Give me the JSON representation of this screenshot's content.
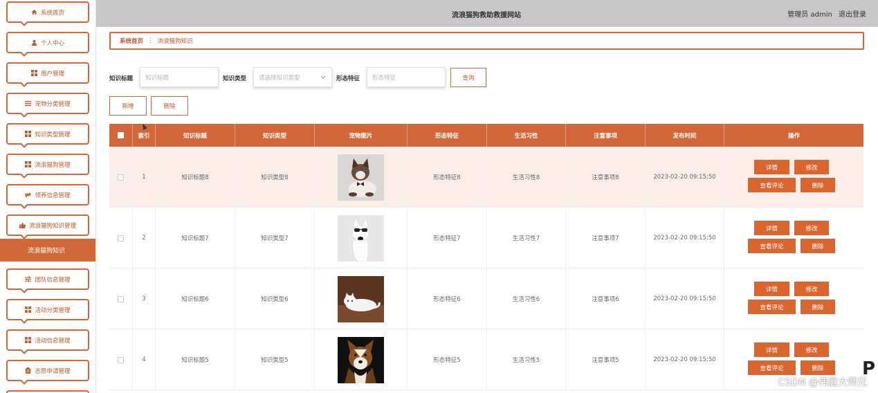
{
  "header": {
    "site_title": "流浪猫狗救助救援网站",
    "user_label": "管理员 admin",
    "logout_label": "退出登录"
  },
  "sidebar": {
    "items": [
      {
        "label": "系统首页",
        "icon": "home-icon"
      },
      {
        "label": "个人中心",
        "icon": "user-icon"
      },
      {
        "label": "用户管理",
        "icon": "grid-icon"
      },
      {
        "label": "宠物分类管理",
        "icon": "list-icon"
      },
      {
        "label": "知识类型管理",
        "icon": "grid-icon"
      },
      {
        "label": "流浪猫狗管理",
        "icon": "grid-icon"
      },
      {
        "label": "领养信息管理",
        "icon": "swap-icon"
      },
      {
        "label": "流浪猫狗知识管理",
        "icon": "thumb-icon"
      },
      {
        "label": "流浪猫狗知识",
        "icon": ""
      },
      {
        "label": "团队信息管理",
        "icon": "sliders-icon"
      },
      {
        "label": "活动分类管理",
        "icon": "grid-icon"
      },
      {
        "label": "活动信息管理",
        "icon": "grid-icon"
      },
      {
        "label": "志愿申请管理",
        "icon": "clipboard-icon"
      }
    ]
  },
  "breadcrumb": {
    "home": "系统首页",
    "separator": "⋮",
    "current": "流浪猫狗知识"
  },
  "search": {
    "title_label": "知识标题",
    "title_placeholder": "知识标题",
    "type_label": "知识类型",
    "type_placeholder": "请选择知识类型",
    "feature_label": "形态特征",
    "feature_placeholder": "形态特征",
    "query_button": "查询"
  },
  "actions": {
    "add_button": "新增",
    "delete_button": "删除"
  },
  "table": {
    "columns": [
      "索引",
      "知识标题",
      "知识类型",
      "宠物图片",
      "形态特征",
      "生活习性",
      "注意事项",
      "发布时间",
      "操作"
    ],
    "op_labels": {
      "detail": "详情",
      "edit": "修改",
      "comments": "查看评论",
      "delete": "删除"
    },
    "rows": [
      {
        "index": "1",
        "title": "知识标题8",
        "type": "知识类型8",
        "image": "cat-with-bowtie",
        "feature": "形态特征8",
        "habit": "生活习性8",
        "note": "注意事项8",
        "time": "2023-02-20 09:15:50"
      },
      {
        "index": "2",
        "title": "知识标题7",
        "type": "知识类型7",
        "image": "white-dog-with-sunglasses",
        "feature": "形态特征7",
        "habit": "生活习性7",
        "note": "注意事项7",
        "time": "2023-02-20 09:15:50"
      },
      {
        "index": "3",
        "title": "知识标题6",
        "type": "知识类型6",
        "image": "white-cat-lying",
        "feature": "形态特征6",
        "habit": "生活习性6",
        "note": "注意事项6",
        "time": "2023-02-20 09:15:50"
      },
      {
        "index": "4",
        "title": "知识标题5",
        "type": "知识类型5",
        "image": "brown-dog-portrait",
        "feature": "形态特征5",
        "habit": "生活习性5",
        "note": "注意事项5",
        "time": "2023-02-20 09:15:50"
      }
    ]
  },
  "watermark": "CSDN @伟庭大师兄",
  "colors": {
    "accent": "#d2683a",
    "header_bg": "#c8c8c8",
    "row_hover": "#fbeee8"
  }
}
